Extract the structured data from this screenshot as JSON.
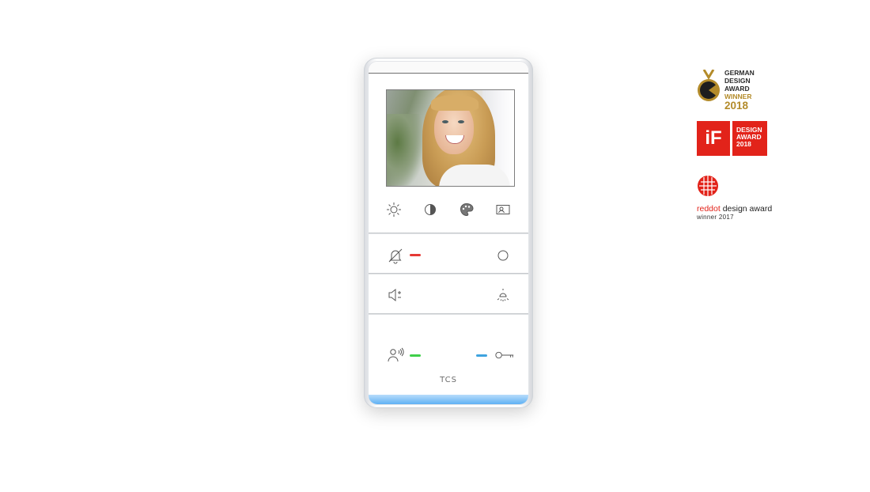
{
  "device": {
    "brand": "TCS",
    "function_icons": [
      "brightness-icon",
      "contrast-icon",
      "color-icon",
      "camera-view-icon"
    ],
    "buttons": {
      "row1": [
        "bell-mute-icon",
        "circle-button-icon"
      ],
      "row2": [
        "volume-icon",
        "light-icon"
      ],
      "row3": [
        "speak-icon",
        "door-key-icon"
      ]
    },
    "led_colors": {
      "mute": "#e53935",
      "speak": "#3fcf4a",
      "door": "#3ea3df"
    },
    "light_bar_color": "#5fb1f4"
  },
  "awards": {
    "german_design": {
      "line1": "GERMAN",
      "line2": "DESIGN",
      "line3": "AWARD",
      "line4": "WINNER",
      "line5": "2018"
    },
    "if_award": {
      "logo": "iF",
      "line1": "DESIGN",
      "line2": "AWARD",
      "line3": "2018"
    },
    "reddot": {
      "red": "reddot",
      "rest": " design award",
      "sub": "winner 2017"
    }
  }
}
